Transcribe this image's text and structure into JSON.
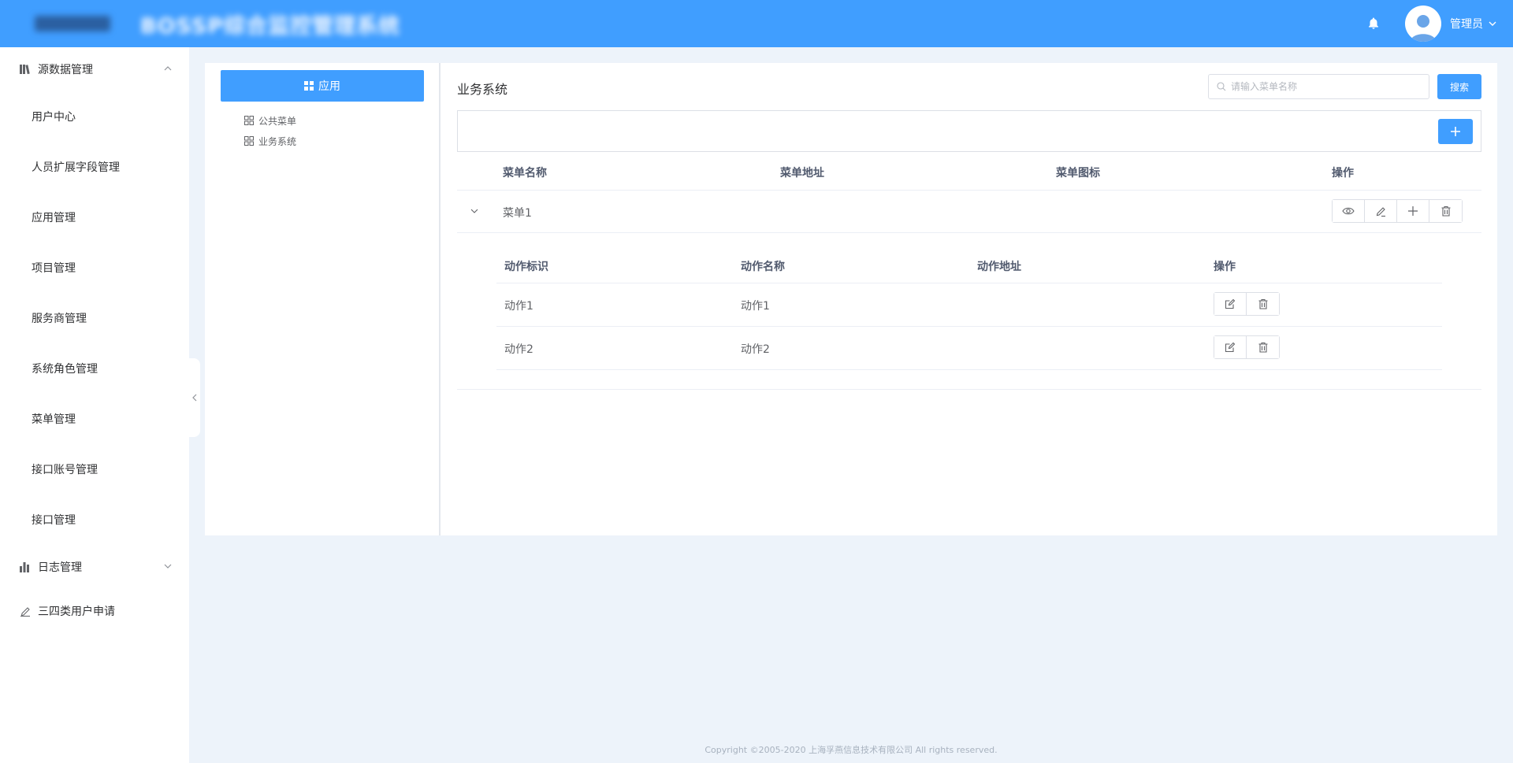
{
  "header": {
    "app_title": "BOSSP综合监控管理系统",
    "user_name": "管理员"
  },
  "sidebar": {
    "groups": [
      {
        "label": "源数据管理",
        "icon": "library-icon",
        "expanded": true,
        "items": [
          {
            "label": "用户中心"
          },
          {
            "label": "人员扩展字段管理"
          },
          {
            "label": "应用管理"
          },
          {
            "label": "项目管理"
          },
          {
            "label": "服务商管理"
          },
          {
            "label": "系统角色管理"
          },
          {
            "label": "菜单管理"
          },
          {
            "label": "接口账号管理"
          },
          {
            "label": "接口管理"
          }
        ]
      },
      {
        "label": "日志管理",
        "icon": "bar-chart-icon",
        "expanded": false
      },
      {
        "label": "三四类用户申请",
        "icon": "edit-pen-icon"
      }
    ]
  },
  "left_panel": {
    "app_button_label": "应用",
    "tree": [
      {
        "label": "公共菜单"
      },
      {
        "label": "业务系统"
      }
    ]
  },
  "main": {
    "title": "业务系统",
    "search": {
      "placeholder": "请输入菜单名称",
      "value": ""
    },
    "search_button_label": "搜索",
    "table": {
      "columns": [
        "菜单名称",
        "菜单地址",
        "菜单图标",
        "操作"
      ],
      "rows": [
        {
          "name": "菜单1",
          "address": "",
          "icon": ""
        }
      ]
    },
    "nested_table": {
      "columns": [
        "动作标识",
        "动作名称",
        "动作地址",
        "操作"
      ],
      "rows": [
        {
          "id": "动作1",
          "name": "动作1",
          "address": ""
        },
        {
          "id": "动作2",
          "name": "动作2",
          "address": ""
        }
      ]
    }
  },
  "footer": {
    "copyright": "Copyright ©2005-2020 上海孚燕信息技术有限公司 All rights reserved."
  },
  "colors": {
    "primary": "#409eff",
    "page_bg": "#edf3fa",
    "text": "#606266"
  }
}
